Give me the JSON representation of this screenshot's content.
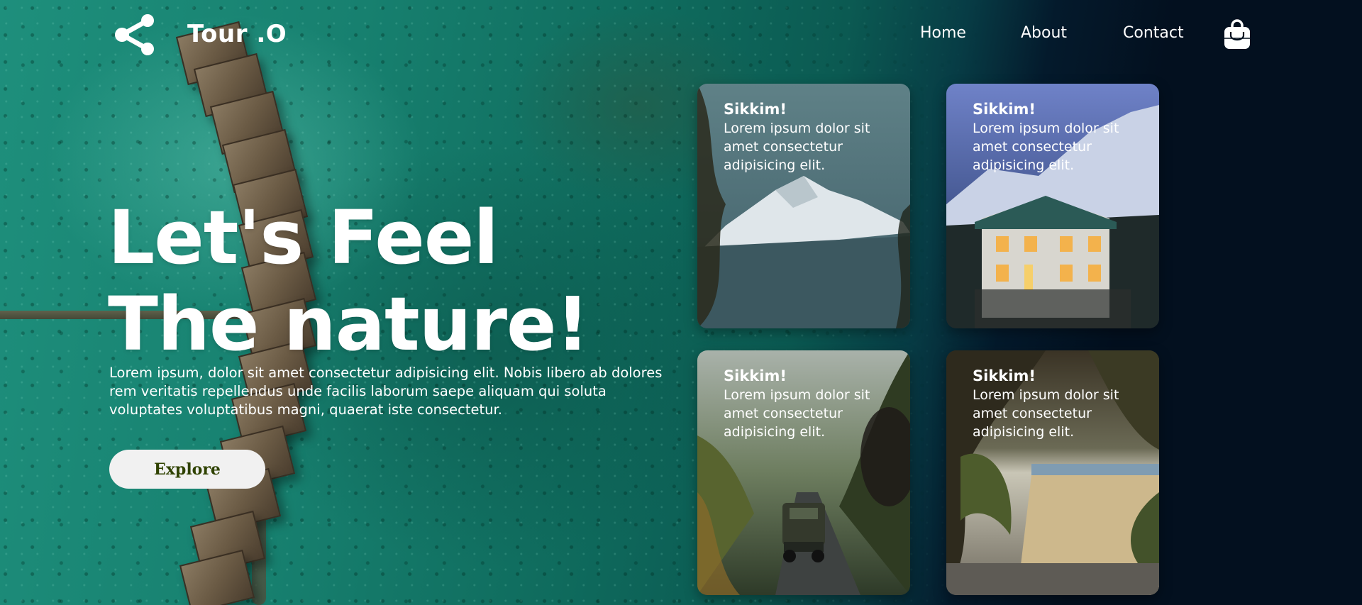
{
  "header": {
    "brand": "Tour .O",
    "logo_icon": "share-icon",
    "cart_icon": "shopping-bag-icon",
    "nav": [
      {
        "label": "Home"
      },
      {
        "label": "About"
      },
      {
        "label": "Contact"
      }
    ]
  },
  "hero": {
    "title_line1": "Let's Feel",
    "title_line2": "The nature!",
    "description": "Lorem ipsum, dolor sit amet consectetur adipisicing elit. Nobis libero ab dolores rem veritatis repellendus unde facilis laborum saepe aliquam qui soluta voluptates voluptatibus magni, quaerat iste consectetur.",
    "cta_label": "Explore"
  },
  "cards": [
    {
      "title": "Sikkim!",
      "text": "Lorem ipsum dolor sit amet consectetur adipisicing elit.",
      "scene": "snow-mountain"
    },
    {
      "title": "Sikkim!",
      "text": "Lorem ipsum dolor sit amet consectetur adipisicing elit.",
      "scene": "mountain-house"
    },
    {
      "title": "Sikkim!",
      "text": "Lorem ipsum dolor sit amet consectetur adipisicing elit.",
      "scene": "jeep-road"
    },
    {
      "title": "Sikkim!",
      "text": "Lorem ipsum dolor sit amet consectetur adipisicing elit.",
      "scene": "beach-path"
    }
  ],
  "colors": {
    "water": "#17806f",
    "night": "#03101f",
    "button_bg": "#f1f1f1",
    "button_text": "#2f4200"
  }
}
